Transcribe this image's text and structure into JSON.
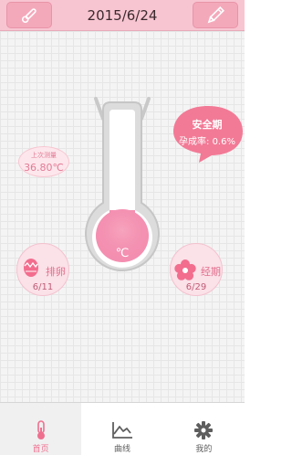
{
  "header": {
    "title": "2015/6/24",
    "left_icon": "thermometer-icon",
    "right_icon": "pencil-icon"
  },
  "thermometer": {
    "unit": "℃",
    "bulb_color": "#f48fb1"
  },
  "last_measurement": {
    "label": "上次测量",
    "value": "36.80℃"
  },
  "safe_period": {
    "title": "安全期",
    "rate": "孕成率: 0.6%",
    "color": "#f27a96"
  },
  "ovulation": {
    "icon": "egg-icon",
    "name": "排卵",
    "date": "6/11"
  },
  "period": {
    "icon": "flower-icon",
    "name": "经期",
    "date": "6/29"
  },
  "nav": {
    "items": [
      {
        "label": "首页",
        "icon": "thermometer-icon",
        "active": true
      },
      {
        "label": "曲线",
        "icon": "chart-icon",
        "active": false
      },
      {
        "label": "我的",
        "icon": "gear-icon",
        "active": false
      }
    ],
    "active_color": "#ef6f8f"
  }
}
